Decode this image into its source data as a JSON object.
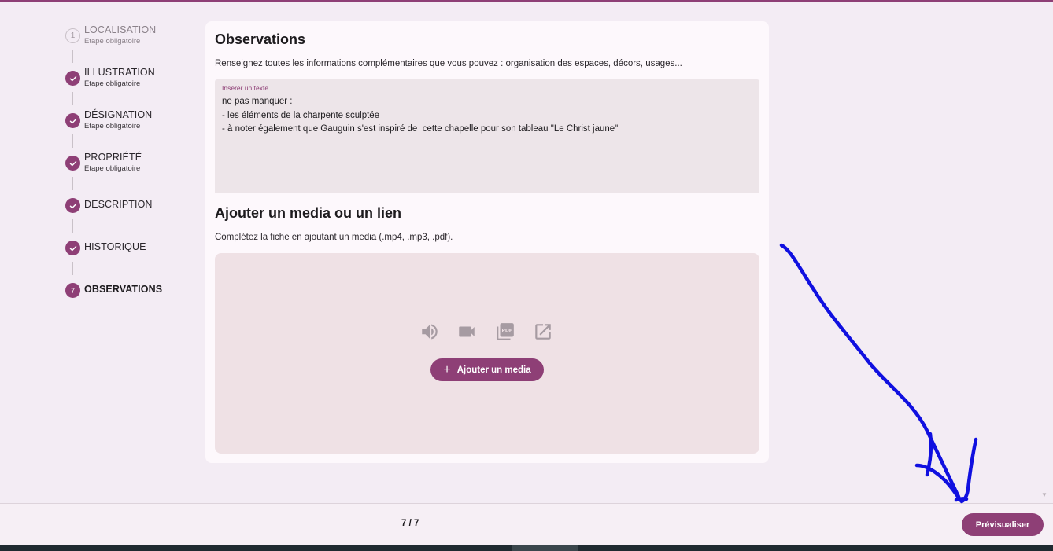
{
  "stepper": {
    "steps": [
      {
        "number": "1",
        "title": "LOCALISATION",
        "subtitle": "Etape obligatoire",
        "state": "pending"
      },
      {
        "title": "ILLUSTRATION",
        "subtitle": "Etape obligatoire",
        "state": "done"
      },
      {
        "title": "DÉSIGNATION",
        "subtitle": "Etape obligatoire",
        "state": "done"
      },
      {
        "title": "PROPRIÉTÉ",
        "subtitle": "Etape obligatoire",
        "state": "done"
      },
      {
        "title": "DESCRIPTION",
        "subtitle": "",
        "state": "done"
      },
      {
        "title": "HISTORIQUE",
        "subtitle": "",
        "state": "done"
      },
      {
        "number": "7",
        "title": "OBSERVATIONS",
        "subtitle": "",
        "state": "active"
      }
    ]
  },
  "observations": {
    "heading": "Observations",
    "description": "Renseignez toutes les informations complémentaires que vous pouvez : organisation des espaces, décors, usages...",
    "field_label": "Insérer un texte",
    "field_value": "ne pas manquer :\n- les éléments de la charpente sculptée\n- à noter également que Gauguin s'est inspiré de  cette chapelle pour son tableau \"Le Christ jaune\""
  },
  "media": {
    "heading": "Ajouter un media ou un lien",
    "description": "Complétez la fiche en ajoutant un media (.mp4, .mp3, .pdf).",
    "icons": [
      "speaker-icon",
      "video-camera-icon",
      "pdf-icon",
      "external-link-icon"
    ],
    "add_button": "Ajouter un media"
  },
  "footer": {
    "page_count": "7 / 7",
    "preview_button": "Prévisualiser"
  },
  "colors": {
    "accent": "#8e3f76",
    "background": "#f3ecf4",
    "card": "#fdf8fc",
    "annotation": "#1010e0"
  }
}
